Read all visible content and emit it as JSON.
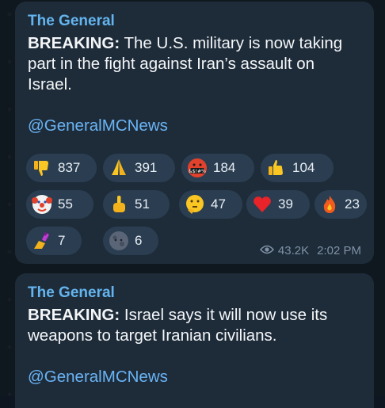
{
  "messages": [
    {
      "sender": "The General",
      "bold_prefix": "BREAKING:",
      "text": " The U.S. military is now taking part in the fight against Iran’s assault on Israel.",
      "link": "@GeneralMCNews",
      "reactions": [
        {
          "icon": "thumbs-down-icon",
          "count": "837"
        },
        {
          "icon": "praying-hands-icon",
          "count": "391"
        },
        {
          "icon": "cursing-face-icon",
          "count": "184"
        },
        {
          "icon": "thumbs-up-icon",
          "count": "104"
        },
        {
          "icon": "clown-face-icon",
          "count": "55"
        },
        {
          "icon": "middle-finger-icon",
          "count": "51"
        },
        {
          "icon": "thinking-face-icon",
          "count": "47"
        },
        {
          "icon": "red-heart-icon",
          "count": "39"
        },
        {
          "icon": "fire-icon",
          "count": "23"
        },
        {
          "icon": "nail-polish-icon",
          "count": "7"
        },
        {
          "icon": "new-moon-face-icon",
          "count": "6"
        }
      ],
      "views": "43.2K",
      "time": "2:02 PM"
    },
    {
      "sender": "The General",
      "bold_prefix": "BREAKING:",
      "text": " Israel says it will now use its weapons to target Iranian civilians.",
      "link": "@GeneralMCNews"
    }
  ],
  "colors": {
    "background": "#10181f",
    "bubble": "#1e2c3a",
    "chip": "#2b3e51",
    "sender": "#64b5ef",
    "link": "#6ab3f3",
    "meta": "#7f91a4"
  }
}
